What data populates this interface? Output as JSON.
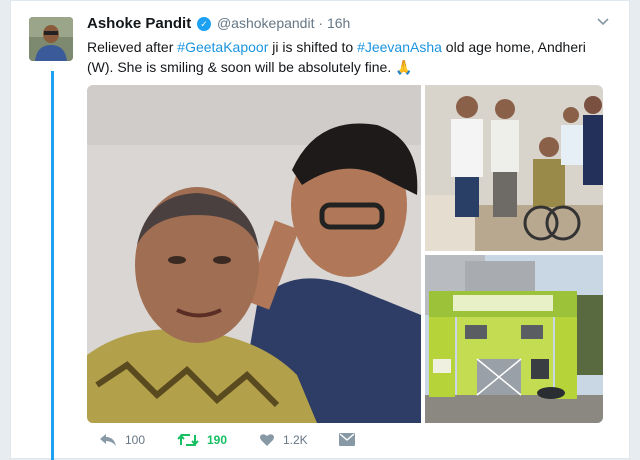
{
  "tweet": {
    "author_name": "Ashoke Pandit",
    "handle": "@ashokepandit",
    "separator": "·",
    "time": "16h",
    "text_parts": {
      "p1": "Relieved after ",
      "tag1": "#GeetaKapoor",
      "p2": " ji is  shifted to ",
      "tag2": "#JeevanAsha",
      "p3": " old age home, Andheri (W). She is smiling & soon will be absolutely fine. "
    }
  },
  "actions": {
    "reply_count": "100",
    "retweet_count": "190",
    "like_count": "1.2K"
  },
  "colors": {
    "accent": "#1da1f2",
    "link": "#1b95e0",
    "retweet": "#17bf63",
    "muted": "#657786"
  },
  "icons": {
    "verified": "verified-badge-icon",
    "caret": "chevron-down-icon",
    "reply": "reply-icon",
    "retweet": "retweet-icon",
    "like": "heart-icon",
    "dm": "envelope-icon",
    "emoji": "folded-hands-emoji"
  }
}
